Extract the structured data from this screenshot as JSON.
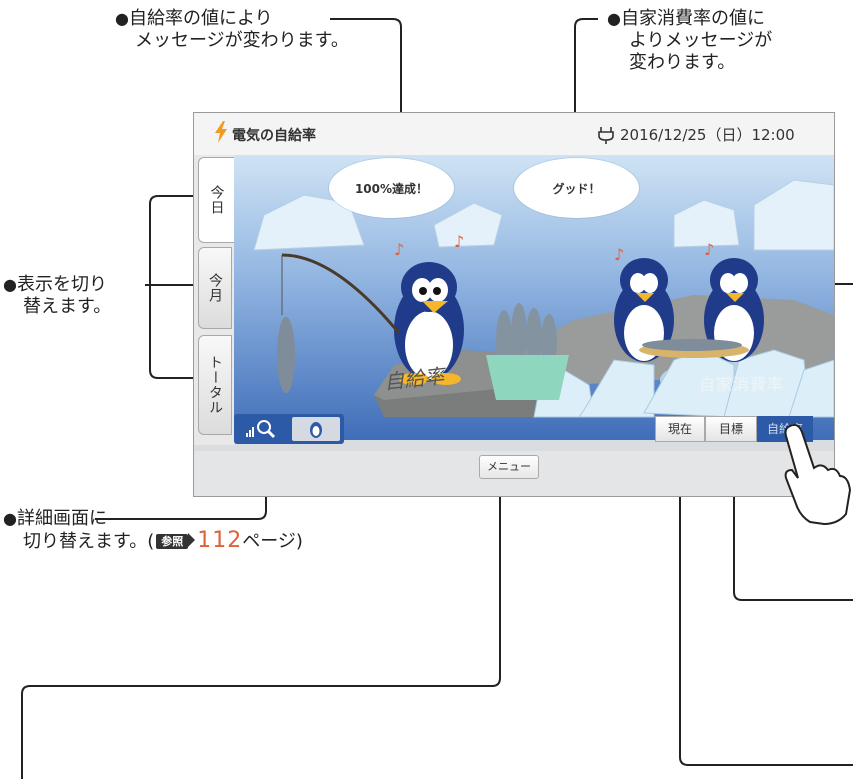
{
  "annotations": {
    "self_sufficiency_msg_line1": "自給率の値により",
    "self_sufficiency_msg_line2": "メッセージが変わります。",
    "self_consumption_msg_line1": "自家消費率の値に",
    "self_consumption_msg_line2": "よりメッセージが",
    "self_consumption_msg_line3": "変わります。",
    "switch_display_line1": "表示を切り",
    "switch_display_line2": "替えます。",
    "detail_screen_line1": "詳細画面に",
    "detail_screen_line2": "切り替えます。(",
    "ref_badge": "参照",
    "ref_page": "112",
    "ref_suffix": "ページ)",
    "bullet": "●"
  },
  "screen": {
    "title": "電気の自給率",
    "datetime": "2016/12/25（日）12:00",
    "tabs": [
      {
        "label": "今日",
        "active": true
      },
      {
        "label": "今月",
        "active": false
      },
      {
        "label": "トータル",
        "active": false
      }
    ],
    "bubble_left": "100%達成！",
    "bubble_right": "グッド！",
    "rock_left_label": "自給率",
    "rock_right_label": "自家消費率",
    "menu_label": "メニュー",
    "mode_buttons": [
      {
        "label": "現在",
        "selected": false
      },
      {
        "label": "目標",
        "selected": false
      },
      {
        "label": "自給率",
        "selected": true
      }
    ],
    "view_buttons": [
      "detail-graph-icon",
      "penguin-icon"
    ]
  },
  "colors": {
    "accent_blue": "#2d5aa6",
    "page_number": "#e0603a",
    "sea": "#5d86c6",
    "bolt": "#f39a1e"
  }
}
